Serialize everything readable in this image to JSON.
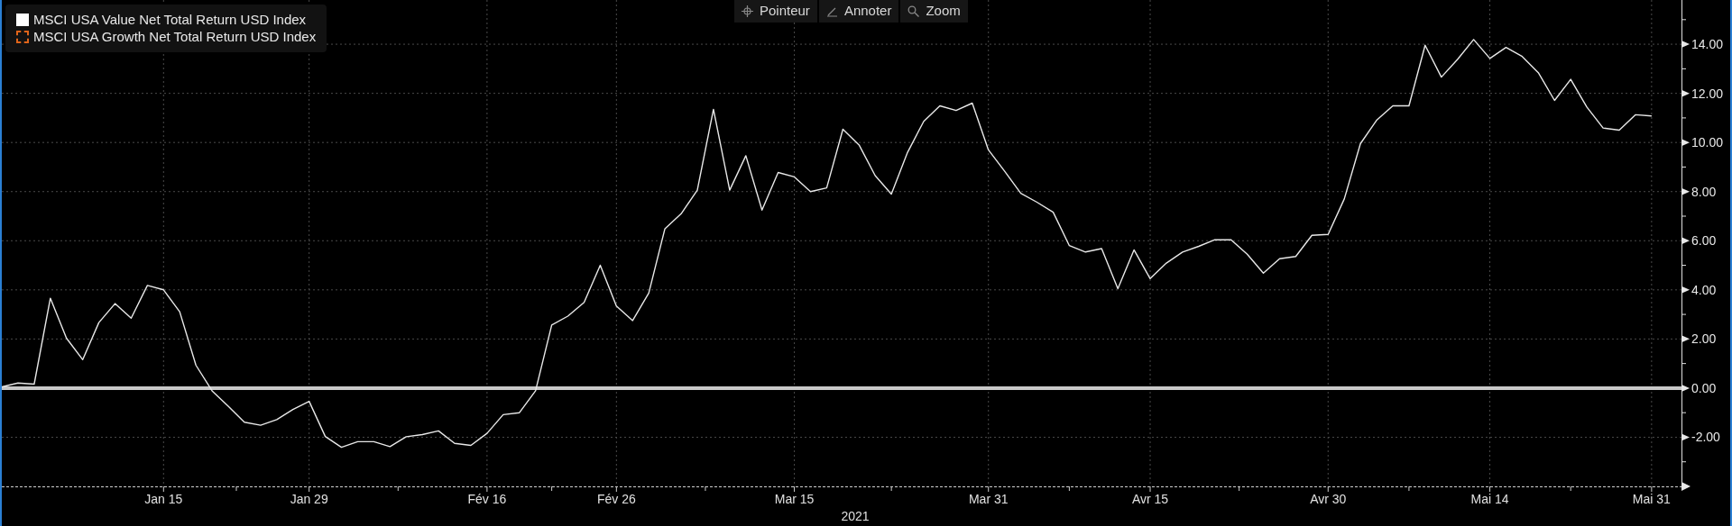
{
  "legend": [
    {
      "kind": "solid",
      "color": "#ffffff"
    },
    {
      "label": "MSCI USA Growth Net Total Return USD Index",
      "kind": "dashed",
      "color": "#e0641a"
    }
  ],
  "toolbar": [
    {
      "label": "Pointeur",
      "kind": "crosshair"
    },
    {
      "label": "Annoter",
      "kind": "pencil"
    },
    {
      "label": "Zoom",
      "kind": "magnifier"
    }
  ],
  "chart": {
    "chart_data": {
      "type": "line",
      "xlabel": "2021",
      "grid": true,
      "categories": [
        null,
        null,
        null,
        null,
        null,
        null,
        null,
        null,
        null,
        null,
        "Jan 15",
        null,
        null,
        null,
        null,
        null,
        null,
        null,
        null,
        "Jan 29",
        null,
        null,
        null,
        null,
        null,
        null,
        null,
        null,
        null,
        null,
        "Fév 16",
        null,
        null,
        null,
        null,
        null,
        null,
        null,
        "Fév 26",
        null,
        null,
        null,
        null,
        null,
        null,
        null,
        null,
        null,
        null,
        "Mar 15",
        null,
        null,
        null,
        null,
        null,
        null,
        null,
        null,
        null,
        null,
        null,
        "Mar 31",
        null,
        null,
        null,
        null,
        null,
        null,
        null,
        null,
        null,
        "Avr 15",
        null,
        null,
        null,
        null,
        null,
        null,
        null,
        null,
        null,
        null,
        "Avr 30",
        null,
        null,
        null,
        null,
        null,
        null,
        null,
        null,
        null,
        "Mai 14",
        null,
        null,
        null,
        null,
        null,
        null,
        null,
        null,
        null,
        "Mai 31"
      ],
      "series": [
        {
          "name": "MSCI USA Value Net Total Return USD Index",
          "color": "#e8e8e8",
          "values": [
            0.05,
            0.21,
            0.16,
            3.66,
            2.03,
            1.16,
            2.67,
            3.44,
            2.85,
            4.18,
            4.0,
            3.11,
            0.93,
            -0.11,
            -0.74,
            -1.39,
            -1.51,
            -1.28,
            -0.87,
            -0.54,
            -1.97,
            -2.41,
            -2.18,
            -2.18,
            -2.38,
            -1.98,
            -1.89,
            -1.74,
            -2.25,
            -2.33,
            -1.84,
            -1.08,
            -1.0,
            -0.11,
            2.57,
            2.93,
            3.49,
            5.0,
            3.34,
            2.75,
            3.87,
            6.49,
            7.1,
            8.06,
            11.35,
            8.06,
            9.46,
            7.25,
            8.78,
            8.6,
            8.0,
            8.15,
            10.54,
            9.9,
            8.65,
            7.9,
            9.6,
            10.86,
            11.49,
            11.3,
            11.6,
            9.7,
            8.83,
            7.93,
            7.57,
            7.16,
            5.8,
            5.54,
            5.68,
            4.05,
            5.63,
            4.46,
            5.09,
            5.54,
            5.77,
            6.04,
            6.04,
            5.45,
            4.68,
            5.27,
            5.36,
            6.22,
            6.26,
            7.7,
            9.95,
            10.9,
            11.49,
            11.49,
            13.96,
            12.66,
            13.38,
            14.19,
            13.42,
            13.87,
            13.5,
            12.84,
            11.71,
            12.57,
            11.44,
            10.59,
            10.5,
            11.13,
            11.08
          ]
        }
      ],
      "ylim": [
        -4,
        15.8
      ],
      "yticks": [
        {
          "value": -2,
          "label": "-2.00"
        },
        {
          "value": 0,
          "label": "0.00"
        },
        {
          "value": 2,
          "label": "2.00"
        },
        {
          "value": 4,
          "label": "4.00"
        },
        {
          "value": 6,
          "label": "6.00"
        },
        {
          "value": 8,
          "label": "8.00"
        },
        {
          "value": 10,
          "label": "10.00"
        },
        {
          "value": 12,
          "label": "12.00"
        },
        {
          "value": 14,
          "label": "14.00"
        }
      ],
      "ref_lines": [
        {
          "axis": "y",
          "value": 0
        }
      ]
    }
  }
}
